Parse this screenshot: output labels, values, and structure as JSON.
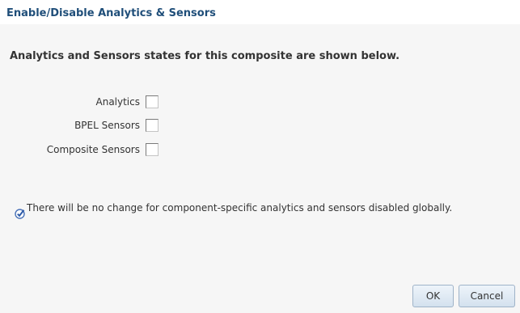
{
  "dialog": {
    "title": "Enable/Disable Analytics & Sensors",
    "instruction": "Analytics and Sensors states for this composite are shown below."
  },
  "options": [
    {
      "label": "Analytics",
      "checked": false
    },
    {
      "label": "BPEL Sensors",
      "checked": false
    },
    {
      "label": "Composite Sensors",
      "checked": false
    }
  ],
  "info": {
    "icon": "info-check-icon",
    "text": "There will be no change for component-specific analytics and sensors disabled globally."
  },
  "buttons": {
    "ok_label": "OK",
    "cancel_label": "Cancel"
  },
  "colors": {
    "title": "#1f4e79",
    "background": "#f6f6f6",
    "icon": "#4b73b8"
  }
}
